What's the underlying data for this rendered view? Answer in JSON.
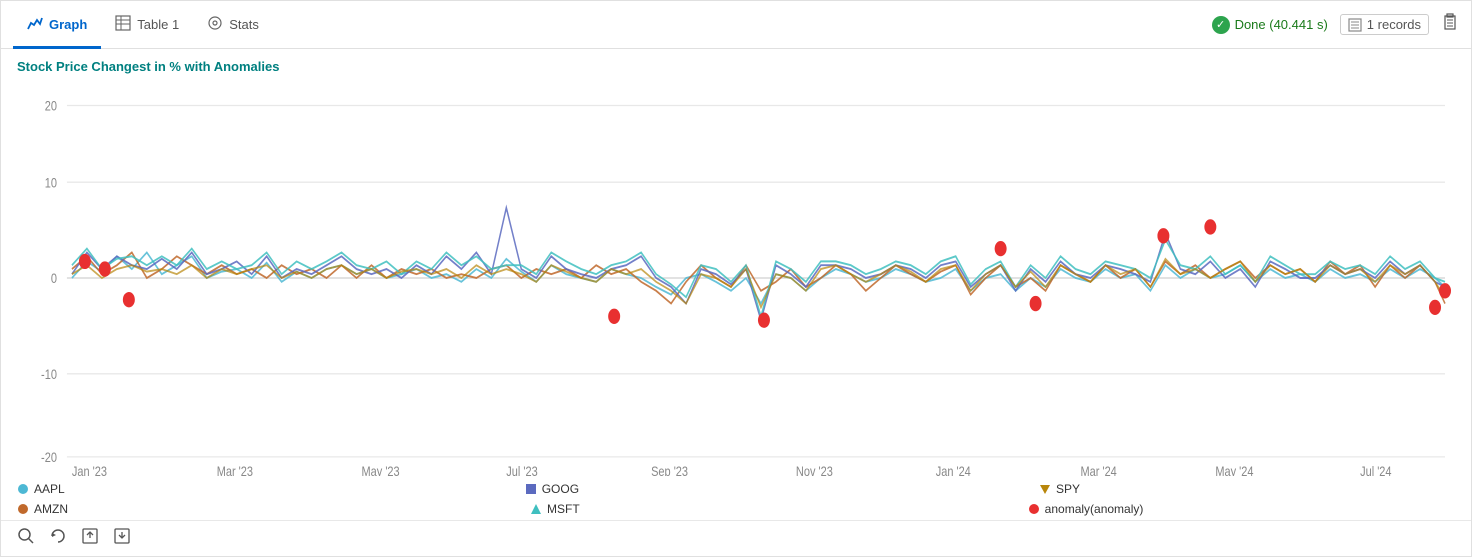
{
  "tabs": [
    {
      "id": "graph",
      "label": "Graph",
      "icon": "📊",
      "active": true
    },
    {
      "id": "table1",
      "label": "Table 1",
      "icon": "⊞",
      "active": false
    },
    {
      "id": "stats",
      "label": "Stats",
      "icon": "◎",
      "active": false
    }
  ],
  "status": {
    "done_label": "Done (40.441 s)",
    "records_label": "1 records"
  },
  "chart": {
    "title": "Stock Price Changest in % with Anomalies",
    "y_labels": [
      "20",
      "10",
      "0",
      "-10",
      "-20"
    ],
    "x_labels": [
      "Jan '23",
      "Mar '23",
      "May '23",
      "Jul '23",
      "Sep '23",
      "Nov '23",
      "Jan '24",
      "Mar '24",
      "May '24",
      "Jul '24"
    ]
  },
  "legend": [
    {
      "id": "aapl",
      "label": "AAPL",
      "color": "#4db8d4",
      "shape": "circle"
    },
    {
      "id": "amzn",
      "label": "AMZN",
      "color": "#c0692c",
      "shape": "circle"
    },
    {
      "id": "goog",
      "label": "GOOG",
      "color": "#5b6abf",
      "shape": "square"
    },
    {
      "id": "msft",
      "label": "MSFT",
      "color": "#3fbfbf",
      "shape": "triangle-up"
    },
    {
      "id": "spy",
      "label": "SPY",
      "color": "#b8860b",
      "shape": "triangle-down"
    },
    {
      "id": "anomaly",
      "label": "anomaly(anomaly)",
      "color": "#e83030",
      "shape": "circle"
    }
  ],
  "toolbar": {
    "search_title": "Search",
    "refresh_title": "Refresh",
    "export_title": "Export",
    "download_title": "Download"
  }
}
